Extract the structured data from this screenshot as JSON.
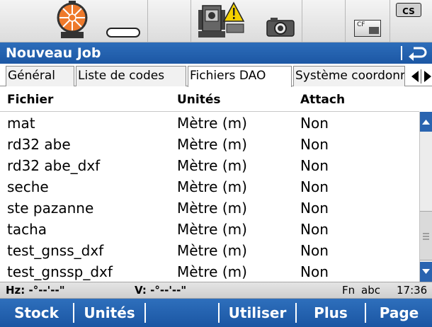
{
  "status_bar": {
    "icons": [
      "target-prism-icon",
      "battery-icon",
      "total-station-warning-icon",
      "camera-icon",
      "cf-card-icon",
      "cs-icon"
    ],
    "cf_label": "CF",
    "cs_label": "CS"
  },
  "title_bar": {
    "title": "Nouveau Job",
    "back_icon": "return-arrow-icon"
  },
  "tabs": [
    {
      "label": "Général",
      "active": false
    },
    {
      "label": "Liste de codes",
      "active": false
    },
    {
      "label": "Fichiers DAO",
      "active": true
    },
    {
      "label": "Système coordonnées",
      "active": false
    }
  ],
  "table": {
    "headers": [
      "Fichier",
      "Unités",
      "Attach"
    ],
    "rows": [
      [
        "mat",
        "Mètre (m)",
        "Non"
      ],
      [
        "rd32 abe",
        "Mètre (m)",
        "Non"
      ],
      [
        "rd32 abe_dxf",
        "Mètre (m)",
        "Non"
      ],
      [
        "seche",
        "Mètre (m)",
        "Non"
      ],
      [
        "ste pazanne",
        "Mètre (m)",
        "Non"
      ],
      [
        "tacha",
        "Mètre (m)",
        "Non"
      ],
      [
        "test_gnss_dxf",
        "Mètre (m)",
        "Non"
      ],
      [
        "test_gnssp_dxf",
        "Mètre (m)",
        "Non"
      ]
    ]
  },
  "info_bar": {
    "hz": "Hz: -°--'--\"",
    "v": "V: -°--'--\"",
    "fn": "Fn",
    "mode": "abc",
    "time": "17:36"
  },
  "fkeys": [
    "Stock",
    "Unités",
    "",
    "Utiliser",
    "Plus",
    "Page"
  ],
  "colors": {
    "accent": "#1f5ca8",
    "target_orange": "#f07b2a",
    "warning_yellow": "#f3d000"
  }
}
